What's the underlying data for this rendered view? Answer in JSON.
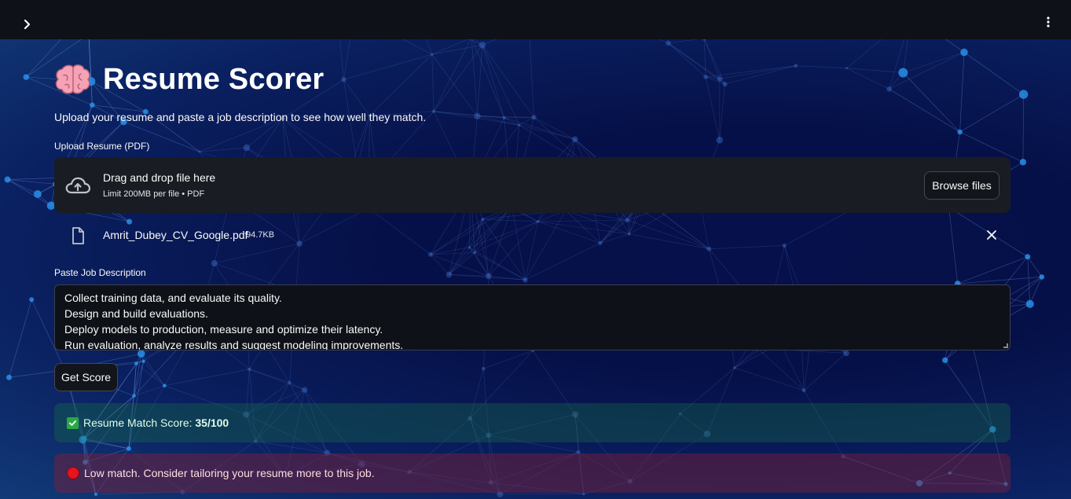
{
  "header": {
    "title": "Resume Scorer",
    "title_emoji": "brain",
    "subtitle": "Upload your resume and paste a job description to see how well they match."
  },
  "uploader": {
    "label": "Upload Resume (PDF)",
    "drag_text": "Drag and drop file here",
    "limit_text": "Limit 200MB per file • PDF",
    "browse_label": "Browse files",
    "icon": "cloud-upload-icon"
  },
  "uploaded_file": {
    "name": "Amrit_Dubey_CV_Google.pdf",
    "size": "94.7KB"
  },
  "job_description": {
    "label": "Paste Job Description",
    "lines": [
      "Collect training data, and evaluate its quality.",
      "Design and build evaluations.",
      "Deploy models to production, measure and optimize their latency.",
      "Run evaluation, analyze results and suggest modeling improvements."
    ]
  },
  "actions": {
    "get_score_label": "Get Score"
  },
  "results": {
    "score_prefix": "Resume Match Score: ",
    "score_value": "35/100",
    "advice": "Low match. Consider tailoring your resume more to this job."
  },
  "colors": {
    "success_bg": "#173b36",
    "error_bg": "#4a1f3a",
    "topbar": "#0e1117"
  }
}
